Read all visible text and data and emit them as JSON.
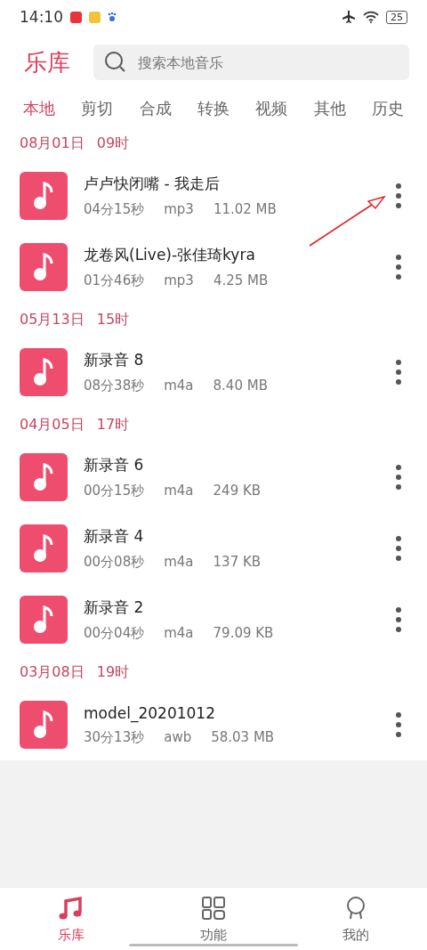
{
  "status_bar": {
    "time": "14:10",
    "battery": "25"
  },
  "header": {
    "title": "乐库",
    "search": {
      "placeholder": "搜索本地音乐"
    }
  },
  "tabs": [
    {
      "label": "本地",
      "selected": true
    },
    {
      "label": "剪切",
      "selected": false
    },
    {
      "label": "合成",
      "selected": false
    },
    {
      "label": "转换",
      "selected": false
    },
    {
      "label": "视频",
      "selected": false
    },
    {
      "label": "其他",
      "selected": false
    },
    {
      "label": "历史",
      "selected": false
    }
  ],
  "groups": [
    {
      "date": "08月01日",
      "hour": "09时",
      "files": [
        {
          "name": "卢卢快闭嘴 - 我走后",
          "duration": "04分15秒",
          "format": "mp3",
          "size": "11.02 MB",
          "annotated": true
        },
        {
          "name": "龙卷风(Live)-张佳琦kyra",
          "duration": "01分46秒",
          "format": "mp3",
          "size": "4.25 MB",
          "annotated": false
        }
      ]
    },
    {
      "date": "05月13日",
      "hour": "15时",
      "files": [
        {
          "name": "新录音 8",
          "duration": "08分38秒",
          "format": "m4a",
          "size": "8.40 MB",
          "annotated": false
        }
      ]
    },
    {
      "date": "04月05日",
      "hour": "17时",
      "files": [
        {
          "name": "新录音 6",
          "duration": "00分15秒",
          "format": "m4a",
          "size": "249 KB",
          "annotated": false
        },
        {
          "name": "新录音 4",
          "duration": "00分08秒",
          "format": "m4a",
          "size": "137 KB",
          "annotated": false
        },
        {
          "name": "新录音 2",
          "duration": "00分04秒",
          "format": "m4a",
          "size": "79.09 KB",
          "annotated": false
        }
      ]
    },
    {
      "date": "03月08日",
      "hour": "19时",
      "files": [
        {
          "name": "model_20201012",
          "duration": "30分13秒",
          "format": "awb",
          "size": "58.03 MB",
          "annotated": false
        }
      ]
    }
  ],
  "bottom_nav": [
    {
      "kind": "music",
      "label": "乐库",
      "selected": true
    },
    {
      "kind": "grid",
      "label": "功能",
      "selected": false
    },
    {
      "kind": "profile",
      "label": "我的",
      "selected": false
    }
  ]
}
